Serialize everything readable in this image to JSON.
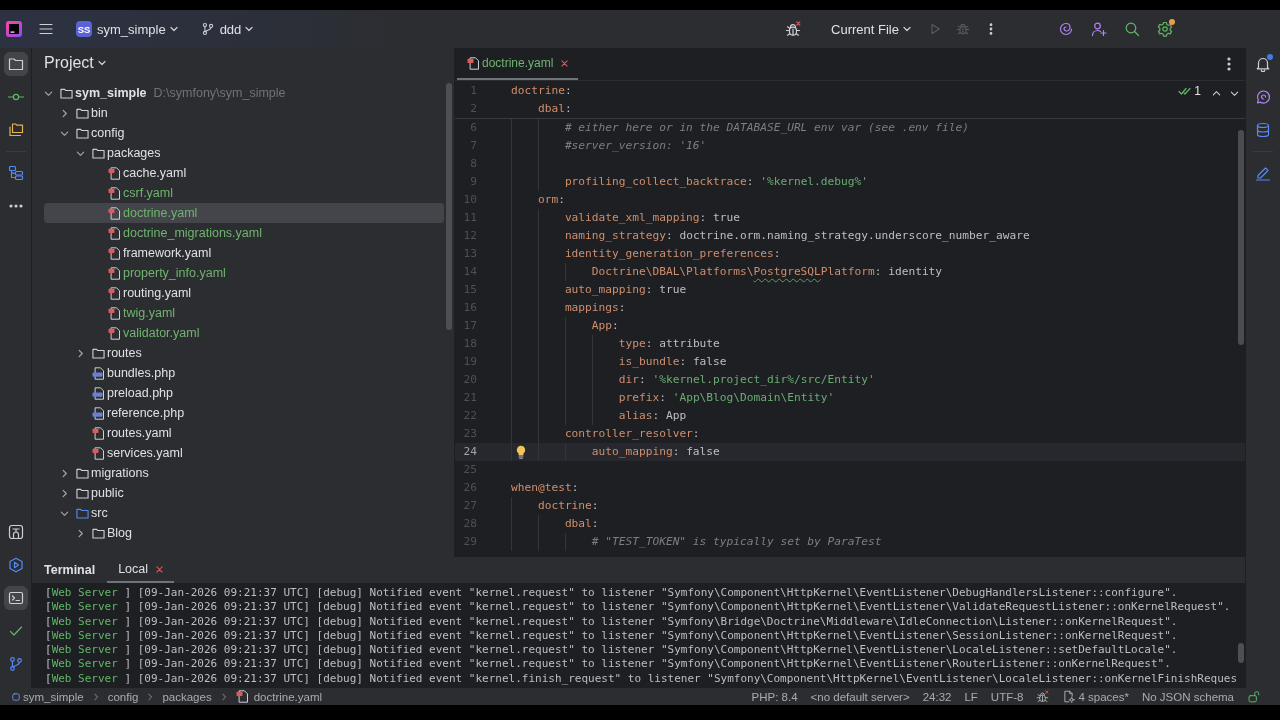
{
  "title_bar": {
    "project_badge": "SS",
    "project": "sym_simple",
    "branch": "ddd",
    "run_config": "Current File",
    "run_actions": [
      {
        "kind": "run",
        "disabled": true
      },
      {
        "kind": "debug",
        "disabled": true
      },
      {
        "kind": "more",
        "disabled": false
      }
    ],
    "actions": [
      {
        "kind": "ai",
        "badge": false
      },
      {
        "kind": "add_user",
        "badge": false
      },
      {
        "kind": "search",
        "badge": false
      },
      {
        "kind": "settings",
        "badge": true
      }
    ]
  },
  "left_tools": {
    "top_groups": [
      [
        {
          "kind": "project",
          "selected": true
        },
        {
          "kind": "commit",
          "selected": false
        },
        {
          "kind": "folders",
          "selected": false
        }
      ],
      [
        {
          "kind": "structure",
          "selected": false
        },
        {
          "kind": "more",
          "selected": false
        }
      ]
    ],
    "bottom": [
      {
        "kind": "plugins",
        "selected": false
      },
      {
        "kind": "run",
        "selected": false
      },
      {
        "kind": "terminal",
        "selected": true
      },
      {
        "kind": "problems",
        "selected": false
      },
      {
        "kind": "git",
        "selected": false
      }
    ]
  },
  "project_panel": {
    "title": "Project",
    "tree": [
      {
        "kind": "folder",
        "name": "sym_simple",
        "path": "D:\\symfony\\sym_simple",
        "expanded": true,
        "source_root": false,
        "selected": false,
        "children": [
          {
            "kind": "folder",
            "name": "bin",
            "expanded": false,
            "source_root": false,
            "selected": false
          },
          {
            "kind": "folder",
            "name": "config",
            "expanded": true,
            "source_root": false,
            "selected": false,
            "children": [
              {
                "kind": "folder",
                "name": "packages",
                "expanded": true,
                "source_root": false,
                "selected": false,
                "children": [
                  {
                    "kind": "yaml",
                    "name": "cache.yaml",
                    "new": false,
                    "selected": false
                  },
                  {
                    "kind": "yaml",
                    "name": "csrf.yaml",
                    "new": true,
                    "selected": false
                  },
                  {
                    "kind": "yaml",
                    "name": "doctrine.yaml",
                    "new": true,
                    "selected": true
                  },
                  {
                    "kind": "yaml",
                    "name": "doctrine_migrations.yaml",
                    "new": true,
                    "selected": false
                  },
                  {
                    "kind": "yaml",
                    "name": "framework.yaml",
                    "new": false,
                    "selected": false
                  },
                  {
                    "kind": "yaml",
                    "name": "property_info.yaml",
                    "new": true,
                    "selected": false
                  },
                  {
                    "kind": "yaml",
                    "name": "routing.yaml",
                    "new": false,
                    "selected": false
                  },
                  {
                    "kind": "yaml",
                    "name": "twig.yaml",
                    "new": true,
                    "selected": false
                  },
                  {
                    "kind": "yaml",
                    "name": "validator.yaml",
                    "new": true,
                    "selected": false
                  }
                ]
              },
              {
                "kind": "folder",
                "name": "routes",
                "expanded": false,
                "source_root": false,
                "selected": false
              },
              {
                "kind": "php",
                "name": "bundles.php",
                "new": false,
                "selected": false
              },
              {
                "kind": "php",
                "name": "preload.php",
                "new": false,
                "selected": false
              },
              {
                "kind": "php",
                "name": "reference.php",
                "new": false,
                "selected": false
              },
              {
                "kind": "yaml",
                "name": "routes.yaml",
                "new": false,
                "selected": false
              },
              {
                "kind": "yaml",
                "name": "services.yaml",
                "new": false,
                "selected": false
              }
            ]
          },
          {
            "kind": "folder",
            "name": "migrations",
            "expanded": false,
            "source_root": false,
            "selected": false
          },
          {
            "kind": "folder",
            "name": "public",
            "expanded": false,
            "source_root": false,
            "selected": false
          },
          {
            "kind": "folder",
            "name": "src",
            "expanded": true,
            "source_root": true,
            "selected": false,
            "children": [
              {
                "kind": "folder",
                "name": "Blog",
                "expanded": false,
                "source_root": false,
                "selected": false
              }
            ]
          }
        ]
      }
    ]
  },
  "editor": {
    "tabs": [
      {
        "kind": "yaml",
        "name": "doctrine.yaml",
        "new": true,
        "selected": true
      }
    ],
    "inspections": {
      "count": "1"
    },
    "code": [
      {
        "number": "1",
        "current": false,
        "tokens": [
          {
            "kind": "key",
            "text": "doctrine"
          },
          {
            "kind": "punct",
            "text": ":"
          }
        ],
        "children": [
          {
            "number": "2",
            "current": false,
            "tokens": [
              {
                "kind": "key",
                "text": "dbal"
              },
              {
                "kind": "punct",
                "text": ":"
              }
            ],
            "children": [
              {
                "number": "6",
                "current": false,
                "tokens": [
                  {
                    "kind": "comment",
                    "text": "# either here or in the DATABASE_URL env var (see .env file)"
                  }
                ]
              },
              {
                "number": "7",
                "current": false,
                "tokens": [
                  {
                    "kind": "comment",
                    "text": "#server_version: '16'"
                  }
                ]
              },
              {
                "number": "8",
                "current": false
              },
              {
                "number": "9",
                "current": false,
                "tokens": [
                  {
                    "kind": "key",
                    "text": "profiling_collect_backtrace"
                  },
                  {
                    "kind": "punct",
                    "text": ": "
                  },
                  {
                    "kind": "string",
                    "text": "'%kernel.debug%'"
                  }
                ]
              }
            ]
          },
          {
            "number": "10",
            "current": false,
            "tokens": [
              {
                "kind": "key",
                "text": "orm"
              },
              {
                "kind": "punct",
                "text": ":"
              }
            ],
            "children": [
              {
                "number": "11",
                "current": false,
                "tokens": [
                  {
                    "kind": "key",
                    "text": "validate_xml_mapping"
                  },
                  {
                    "kind": "punct",
                    "text": ": "
                  },
                  {
                    "kind": "value",
                    "text": "true"
                  }
                ]
              },
              {
                "number": "12",
                "current": false,
                "tokens": [
                  {
                    "kind": "key",
                    "text": "naming_strategy"
                  },
                  {
                    "kind": "punct",
                    "text": ": "
                  },
                  {
                    "kind": "value",
                    "text": "doctrine.orm.naming_strategy.underscore_number_aware"
                  }
                ]
              },
              {
                "number": "13",
                "current": false,
                "tokens": [
                  {
                    "kind": "key",
                    "text": "identity_generation_preferences"
                  },
                  {
                    "kind": "punct",
                    "text": ":"
                  }
                ],
                "children": [
                  {
                    "number": "14",
                    "current": false,
                    "tokens": [
                      {
                        "kind": "key",
                        "text": "Doctrine\\DBAL\\Platforms\\"
                      },
                      {
                        "kind": "key_typo",
                        "text": "PostgreSQL"
                      },
                      {
                        "kind": "key",
                        "text": "Platform"
                      },
                      {
                        "kind": "punct",
                        "text": ": "
                      },
                      {
                        "kind": "value",
                        "text": "identity"
                      }
                    ]
                  }
                ]
              },
              {
                "number": "15",
                "current": false,
                "tokens": [
                  {
                    "kind": "key",
                    "text": "auto_mapping"
                  },
                  {
                    "kind": "punct",
                    "text": ": "
                  },
                  {
                    "kind": "value",
                    "text": "true"
                  }
                ]
              },
              {
                "number": "16",
                "current": false,
                "tokens": [
                  {
                    "kind": "key",
                    "text": "mappings"
                  },
                  {
                    "kind": "punct",
                    "text": ":"
                  }
                ],
                "children": [
                  {
                    "number": "17",
                    "current": false,
                    "tokens": [
                      {
                        "kind": "key",
                        "text": "App"
                      },
                      {
                        "kind": "punct",
                        "text": ":"
                      }
                    ],
                    "children": [
                      {
                        "number": "18",
                        "current": false,
                        "tokens": [
                          {
                            "kind": "key",
                            "text": "type"
                          },
                          {
                            "kind": "punct",
                            "text": ": "
                          },
                          {
                            "kind": "value",
                            "text": "attribute"
                          }
                        ]
                      },
                      {
                        "number": "19",
                        "current": false,
                        "tokens": [
                          {
                            "kind": "key",
                            "text": "is_bundle"
                          },
                          {
                            "kind": "punct",
                            "text": ": "
                          },
                          {
                            "kind": "value",
                            "text": "false"
                          }
                        ]
                      },
                      {
                        "number": "20",
                        "current": false,
                        "tokens": [
                          {
                            "kind": "key",
                            "text": "dir"
                          },
                          {
                            "kind": "punct",
                            "text": ": "
                          },
                          {
                            "kind": "string",
                            "text": "'%kernel.project_dir%/src/Entity'"
                          }
                        ]
                      },
                      {
                        "number": "21",
                        "current": false,
                        "tokens": [
                          {
                            "kind": "key",
                            "text": "prefix"
                          },
                          {
                            "kind": "punct",
                            "text": ": "
                          },
                          {
                            "kind": "string",
                            "text": "'App\\Blog\\Domain\\Entity'"
                          }
                        ]
                      },
                      {
                        "number": "22",
                        "current": false,
                        "tokens": [
                          {
                            "kind": "key",
                            "text": "alias"
                          },
                          {
                            "kind": "punct",
                            "text": ": "
                          },
                          {
                            "kind": "value",
                            "text": "App"
                          }
                        ]
                      }
                    ]
                  }
                ]
              },
              {
                "number": "23",
                "current": false,
                "tokens": [
                  {
                    "kind": "key",
                    "text": "controller_resolver"
                  },
                  {
                    "kind": "punct",
                    "text": ":"
                  }
                ],
                "children": [
                  {
                    "number": "24",
                    "current": true,
                    "tokens": [
                      {
                        "kind": "key",
                        "text": "auto_mapping"
                      },
                      {
                        "kind": "punct",
                        "text": ": "
                      },
                      {
                        "kind": "value",
                        "text": "false"
                      }
                    ]
                  }
                ]
              }
            ]
          }
        ]
      },
      {
        "number": "25",
        "current": false
      },
      {
        "number": "26",
        "current": false,
        "tokens": [
          {
            "kind": "key",
            "text": "when@test"
          },
          {
            "kind": "punct",
            "text": ":"
          }
        ],
        "children": [
          {
            "number": "27",
            "current": false,
            "tokens": [
              {
                "kind": "key",
                "text": "doctrine"
              },
              {
                "kind": "punct",
                "text": ":"
              }
            ],
            "children": [
              {
                "number": "28",
                "current": false,
                "tokens": [
                  {
                    "kind": "key",
                    "text": "dbal"
                  },
                  {
                    "kind": "punct",
                    "text": ":"
                  }
                ],
                "children": [
                  {
                    "number": "29",
                    "current": false,
                    "tokens": [
                      {
                        "kind": "comment",
                        "text": "# \"TEST_TOKEN\" is typically set by ParaTest"
                      }
                    ]
                  }
                ]
              }
            ]
          }
        ]
      }
    ]
  },
  "right_tools": {
    "groups": [
      [
        {
          "kind": "notifications",
          "badge": true
        },
        {
          "kind": "ai_chat",
          "badge": false
        },
        {
          "kind": "database",
          "badge": false
        }
      ],
      [
        {
          "kind": "edit",
          "badge": false
        }
      ]
    ]
  },
  "terminal": {
    "title": "Terminal",
    "tabs": [
      {
        "label": "Local",
        "selected": true
      }
    ],
    "lines": [
      {
        "segments": [
          {
            "kind": "plain",
            "text": "["
          },
          {
            "kind": "source",
            "text": "Web Server"
          },
          {
            "kind": "plain",
            "text": " ] [09-Jan-2026 09:21:37 UTC] [debug] Notified event \"kernel.request\" to listener \"Symfony\\Component\\HttpKernel\\EventListener\\DebugHandlersListener::configure\"."
          }
        ]
      },
      {
        "segments": [
          {
            "kind": "plain",
            "text": "["
          },
          {
            "kind": "source",
            "text": "Web Server"
          },
          {
            "kind": "plain",
            "text": " ] [09-Jan-2026 09:21:37 UTC] [debug] Notified event \"kernel.request\" to listener \"Symfony\\Component\\HttpKernel\\EventListener\\ValidateRequestListener::onKernelRequest\"."
          }
        ]
      },
      {
        "segments": [
          {
            "kind": "plain",
            "text": "["
          },
          {
            "kind": "source",
            "text": "Web Server"
          },
          {
            "kind": "plain",
            "text": " ] [09-Jan-2026 09:21:37 UTC] [debug] Notified event \"kernel.request\" to listener \"Symfony\\Bridge\\Doctrine\\Middleware\\IdleConnection\\Listener::onKernelRequest\"."
          }
        ]
      },
      {
        "segments": [
          {
            "kind": "plain",
            "text": "["
          },
          {
            "kind": "source",
            "text": "Web Server"
          },
          {
            "kind": "plain",
            "text": " ] [09-Jan-2026 09:21:37 UTC] [debug] Notified event \"kernel.request\" to listener \"Symfony\\Component\\HttpKernel\\EventListener\\SessionListener::onKernelRequest\"."
          }
        ]
      },
      {
        "segments": [
          {
            "kind": "plain",
            "text": "["
          },
          {
            "kind": "source",
            "text": "Web Server"
          },
          {
            "kind": "plain",
            "text": " ] [09-Jan-2026 09:21:37 UTC] [debug] Notified event \"kernel.request\" to listener \"Symfony\\Component\\HttpKernel\\EventListener\\LocaleListener::setDefaultLocale\"."
          }
        ]
      },
      {
        "segments": [
          {
            "kind": "plain",
            "text": "["
          },
          {
            "kind": "source",
            "text": "Web Server"
          },
          {
            "kind": "plain",
            "text": " ] [09-Jan-2026 09:21:37 UTC] [debug] Notified event \"kernel.request\" to listener \"Symfony\\Component\\HttpKernel\\EventListener\\RouterListener::onKernelRequest\"."
          }
        ]
      },
      {
        "segments": [
          {
            "kind": "plain",
            "text": "["
          },
          {
            "kind": "source",
            "text": "Web Server"
          },
          {
            "kind": "plain",
            "text": " ] [09-Jan-2026 09:21:37 UTC] [debug] Notified event \"kernel.finish_request\" to listener \"Symfony\\Component\\HttpKernel\\EventListener\\LocaleListener::onKernelFinishReques"
          }
        ]
      }
    ]
  },
  "status_bar": {
    "breadcrumbs": [
      {
        "kind": "project",
        "label": "sym_simple"
      },
      {
        "kind": "folder",
        "label": "config"
      },
      {
        "kind": "folder",
        "label": "packages"
      },
      {
        "kind": "yaml",
        "label": "doctrine.yaml"
      }
    ],
    "items": [
      {
        "kind": "text",
        "label": "PHP: 8.4"
      },
      {
        "kind": "text",
        "label": "<no default server>"
      },
      {
        "kind": "text",
        "label": "24:32"
      },
      {
        "kind": "text",
        "label": "LF"
      },
      {
        "kind": "text",
        "label": "UTF-8"
      },
      {
        "kind": "bug"
      },
      {
        "kind": "indent",
        "label": "4 spaces*"
      },
      {
        "kind": "text",
        "label": "No JSON schema"
      },
      {
        "kind": "lock"
      }
    ]
  }
}
